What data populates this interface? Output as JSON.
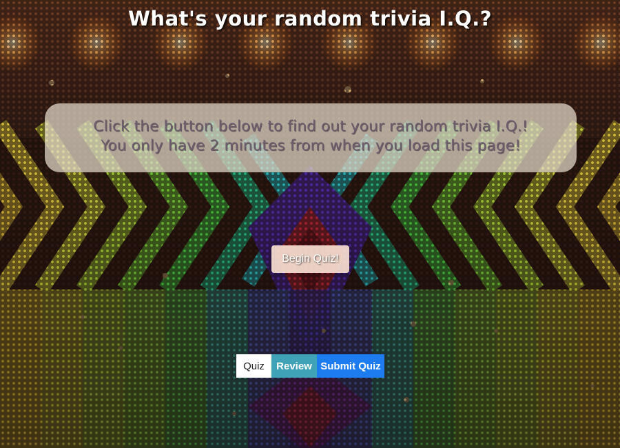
{
  "page": {
    "title": "What's your random trivia I.Q.?"
  },
  "intro": {
    "line1": "Click the button below to find out your random trivia I.Q.!",
    "line2": "You only have 2 minutes from when you load this page!"
  },
  "begin_button": {
    "label": "Begin Quiz!"
  },
  "tabs": [
    {
      "label": "Quiz"
    },
    {
      "label": "Review"
    },
    {
      "label": "Submit Quiz"
    }
  ],
  "colors": {
    "review_tab": "#3fa2b7",
    "submit_tab": "#1c7cf0",
    "quiz_tab": "#ffffff"
  }
}
